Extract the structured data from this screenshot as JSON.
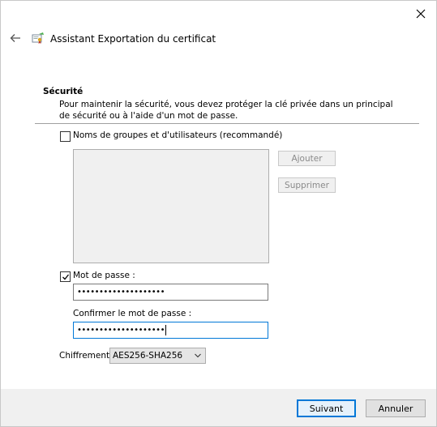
{
  "wizard": {
    "title": "Assistant Exportation du certificat"
  },
  "section": {
    "title": "Sécurité",
    "description": "Pour maintenir la sécurité, vous devez protéger la clé privée dans un principal de sécurité ou à l'aide d'un mot de passe."
  },
  "groups": {
    "checkbox_label": "Noms de groupes et d'utilisateurs (recommandé)",
    "checked": false,
    "add_label": "Ajouter",
    "remove_label": "Supprimer"
  },
  "password": {
    "checkbox_label": "Mot de passe :",
    "checked": true,
    "value": "••••••••••••••••••••",
    "confirm_label": "Confirmer le mot de passe :",
    "confirm_value": "••••••••••••••••••••"
  },
  "encryption": {
    "label": "Chiffrement",
    "selected": "AES256-SHA256"
  },
  "footer": {
    "next_label": "Suivant",
    "cancel_label": "Annuler"
  },
  "colors": {
    "accent": "#0078d7",
    "footer_bg": "#f0f0f0"
  }
}
